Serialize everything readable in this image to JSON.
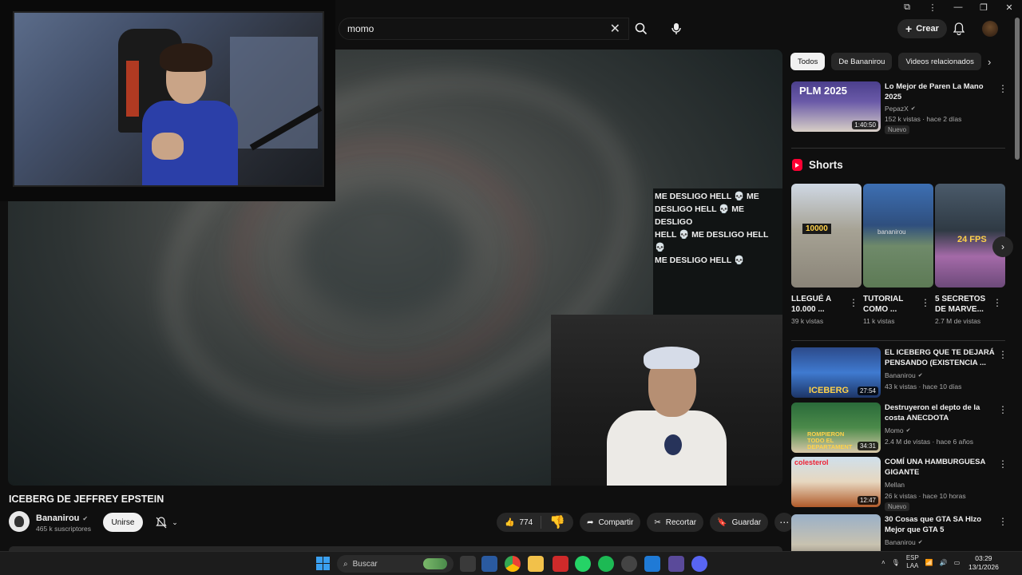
{
  "search": {
    "query": "momo"
  },
  "header": {
    "create_label": "Crear"
  },
  "video": {
    "title": "ICEBERG DE JEFFREY EPSTEIN",
    "overlay_text": [
      "ME DESLIGO HELL 💀 ME",
      "DESLIGO HELL 💀 ME DESLIGO",
      "HELL 💀 ME DESLIGO HELL 💀",
      "ME DESLIGO HELL 💀"
    ]
  },
  "channel": {
    "name": "Bananirou",
    "subscribers": "465 k suscriptores",
    "join_label": "Unirse"
  },
  "actions": {
    "likes": "774",
    "share": "Compartir",
    "clip": "Recortar",
    "save": "Guardar"
  },
  "chips": [
    "Todos",
    "De Bananirou",
    "Videos relacionados"
  ],
  "recommended_top": {
    "title": "Lo Mejor de Paren La Mano 2025",
    "channel": "PepazX",
    "meta": "152 k vistas · hace 2 días",
    "badge": "Nuevo",
    "duration": "1:40:50",
    "thumb_text": "PLM 2025"
  },
  "shorts": {
    "heading": "Shorts",
    "items": [
      {
        "title": "LLEGUÉ A 10.000 ...",
        "views": "39 k vistas",
        "overlay": "10000"
      },
      {
        "title": "TUTORIAL COMO ...",
        "views": "11 k vistas",
        "overlay": "bananirou"
      },
      {
        "title": "5 SECRETOS DE MARVE...",
        "views": "2.7 M de vistas",
        "overlay": "24 FPS"
      }
    ]
  },
  "recommended": [
    {
      "title": "EL ICEBERG QUE TE DEJARÁ PENSANDO (EXISTENCIA ...",
      "channel": "Bananirou",
      "meta": "43 k vistas · hace 10 días",
      "duration": "27:54",
      "badge": "",
      "verified": true,
      "thumb_text": "ICEBERG"
    },
    {
      "title": "Destruyeron el depto de la costa ANECDOTA",
      "channel": "Momo",
      "meta": "2.4 M de vistas · hace 6 años",
      "duration": "34:31",
      "badge": "",
      "verified": true,
      "thumb_text": "ROMPIERON TODO EL DEPARTAMENT"
    },
    {
      "title": "COMÍ UNA HAMBURGUESA GIGANTE",
      "channel": "Mellan",
      "meta": "26 k vistas · hace 10 horas",
      "duration": "12:47",
      "badge": "Nuevo",
      "verified": false,
      "thumb_text": "colesterol"
    },
    {
      "title": "30 Cosas que GTA SA HIzo Mejor que GTA 5",
      "channel": "Bananirou",
      "meta": "",
      "duration": "",
      "badge": "",
      "verified": true,
      "thumb_text": ""
    }
  ],
  "taskbar": {
    "search_label": "Buscar",
    "lang": "ESP",
    "lang2": "LAA",
    "time": "03:29",
    "date": "13/1/2026"
  },
  "colors": {
    "accent": "#ff0033",
    "bg": "#0f0f0f",
    "chip": "#272727"
  }
}
